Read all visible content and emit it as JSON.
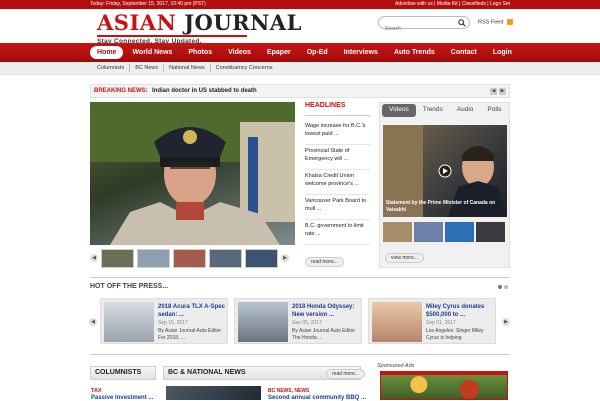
{
  "topbar": {
    "date": "Today: Friday, September 15, 2017, 10:40 pm (PST)",
    "links": "Advertise with us | Media Kit | Classifieds | Logo Set"
  },
  "brand": {
    "name_part1": "ASIAN",
    "name_part2": "JOURNAL",
    "tagline": "Stay Connected. Stay Updated."
  },
  "search": {
    "placeholder": "Search"
  },
  "rss": {
    "label": "RSS Feed"
  },
  "nav": {
    "items": [
      "Home",
      "World News",
      "Photos",
      "Videos",
      "Epaper",
      "Op-Ed",
      "Interviews",
      "Auto Trends",
      "Contact",
      "Login"
    ]
  },
  "subnav": {
    "items": [
      "Columnists",
      "BC News",
      "National News",
      "Constituency Concerns"
    ]
  },
  "breaking": {
    "label": "BREAKING NEWS:",
    "text": "Indian doctor in US stabbed to death"
  },
  "headlines": {
    "title": "HEADLINES",
    "items": [
      "Wage increase for B.C.'s lowest paid ...",
      "Provincial State of Emergency will ...",
      "Khalsa Credit Union welcome province's ...",
      "Vancouver Park Board to mull ...",
      "B.C. government to limit rate ..."
    ],
    "read_more": "read more..."
  },
  "media": {
    "tabs": [
      "Videos",
      "Trends",
      "Audio",
      "Polls"
    ],
    "caption": "Statement by the Prime Minister of Canada on Vaisakhi",
    "view_more": "view more..."
  },
  "hot": {
    "title": "HOT OFF THE PRESS...",
    "cards": [
      {
        "title": "2018 Acura TLX A-Spec sedan: ...",
        "date": "Sep 15, 2017",
        "excerpt": "By Asian Journal Auto Editor For 2018, ..."
      },
      {
        "title": "2018 Honda Odyssey: New version ...",
        "date": "Sep 05, 2017",
        "excerpt": "By Asian Journal Auto Editor The Honda ..."
      },
      {
        "title": "Miley Cyrus donates $500,000 to ...",
        "date": "Sep 01, 2017",
        "excerpt": "Los Angeles: Singer Miley Cyrus is helping"
      }
    ]
  },
  "columnists": {
    "title": "COLUMNISTS",
    "tag": "TAX",
    "link": "Passive Investment ..."
  },
  "bcnews": {
    "title": "BC & NATIONAL NEWS",
    "read_more": "read more...",
    "tag": "BC NEWS, NEWS",
    "link": "Second annual community BBQ ..."
  },
  "sponsored": {
    "label": "Sponsored Ads"
  },
  "colors": {
    "brand_red": "#c81212",
    "nav_red": "#b30e0e",
    "link_blue": "#1a3d8f"
  },
  "icons": [
    "search-icon",
    "rss-icon",
    "play-icon",
    "chevron-left-icon",
    "chevron-right-icon"
  ]
}
